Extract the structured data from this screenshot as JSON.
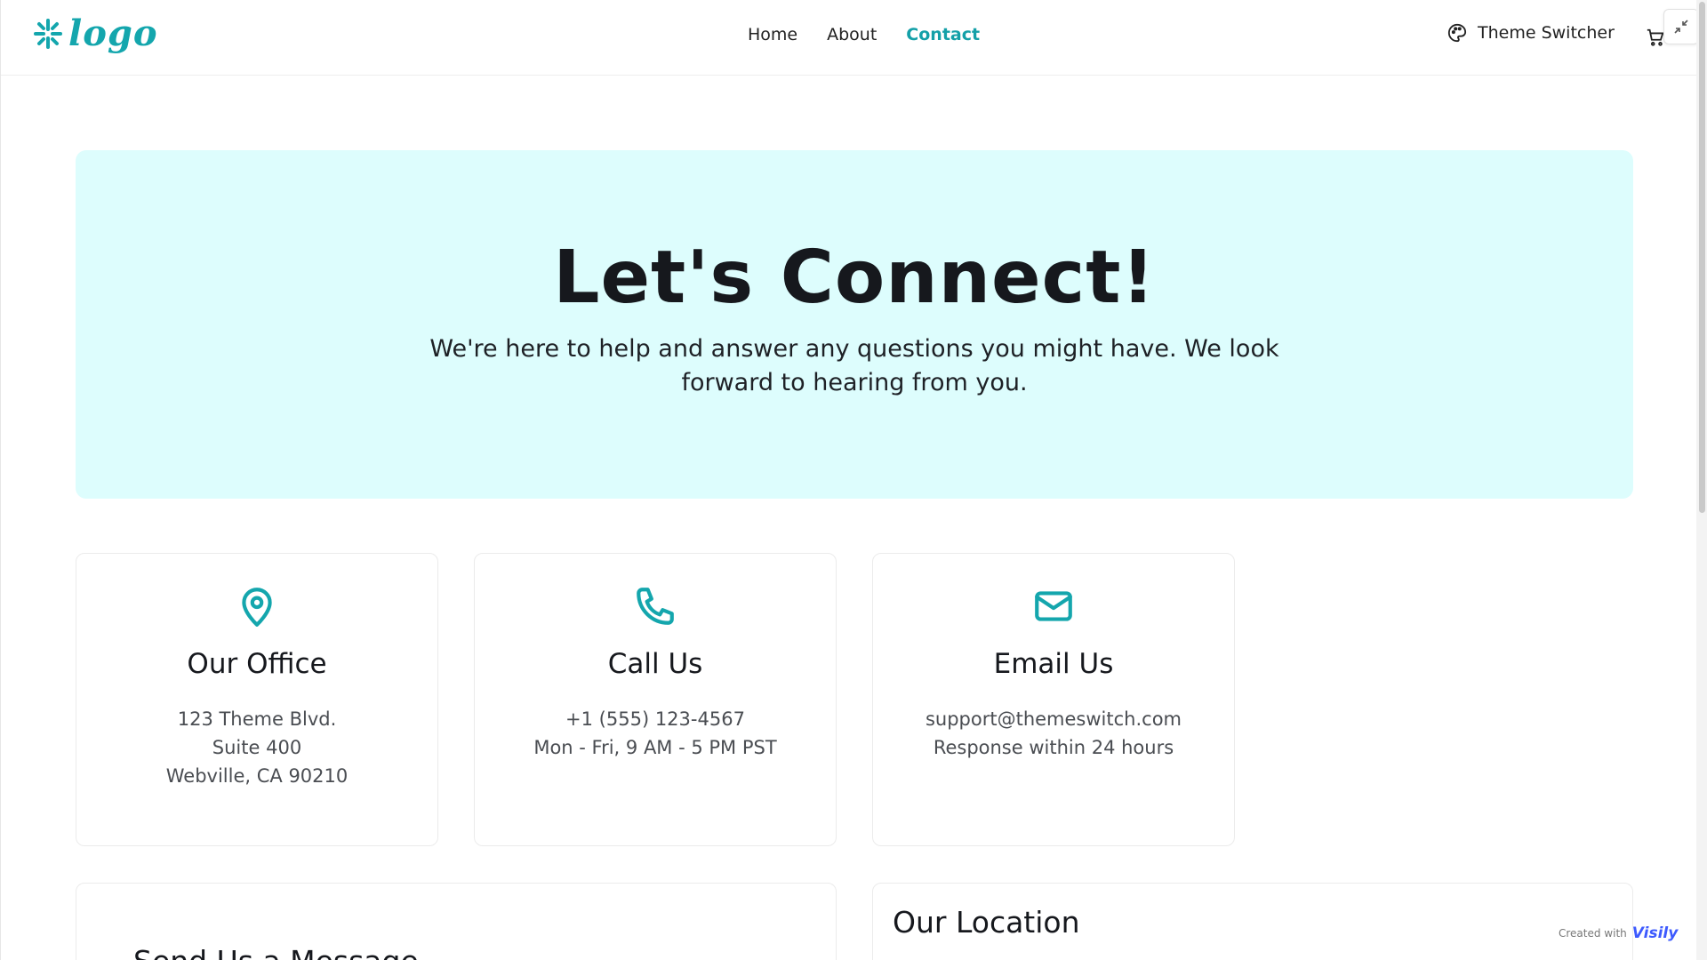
{
  "header": {
    "logo_text": "logo",
    "nav": [
      {
        "label": "Home",
        "active": false
      },
      {
        "label": "About",
        "active": false
      },
      {
        "label": "Contact",
        "active": true
      }
    ],
    "theme_switcher_label": "Theme Switcher",
    "cart_icon": "cart-icon",
    "collapse_icon": "collapse-icon"
  },
  "hero": {
    "title": "Let's Connect!",
    "subtitle": "We're here to help and answer any questions you might have. We look forward to hearing from you."
  },
  "cards": [
    {
      "icon": "map-pin-icon",
      "title": "Our Office",
      "lines": [
        "123 Theme Blvd.",
        "Suite 400",
        "Webville, CA 90210"
      ]
    },
    {
      "icon": "phone-icon",
      "title": "Call Us",
      "lines": [
        "+1 (555) 123-4567",
        "Mon - Fri, 9 AM - 5 PM PST"
      ]
    },
    {
      "icon": "mail-icon",
      "title": "Email Us",
      "lines": [
        "support@themeswitch.com",
        "Response within 24 hours"
      ]
    }
  ],
  "message_section": {
    "title": "Send Us a Message"
  },
  "location_section": {
    "title": "Our Location"
  },
  "badge": {
    "prefix": "Created with",
    "brand": "Visily"
  },
  "colors": {
    "accent": "#14a6ad",
    "hero_bg": "#ddfdfd"
  }
}
